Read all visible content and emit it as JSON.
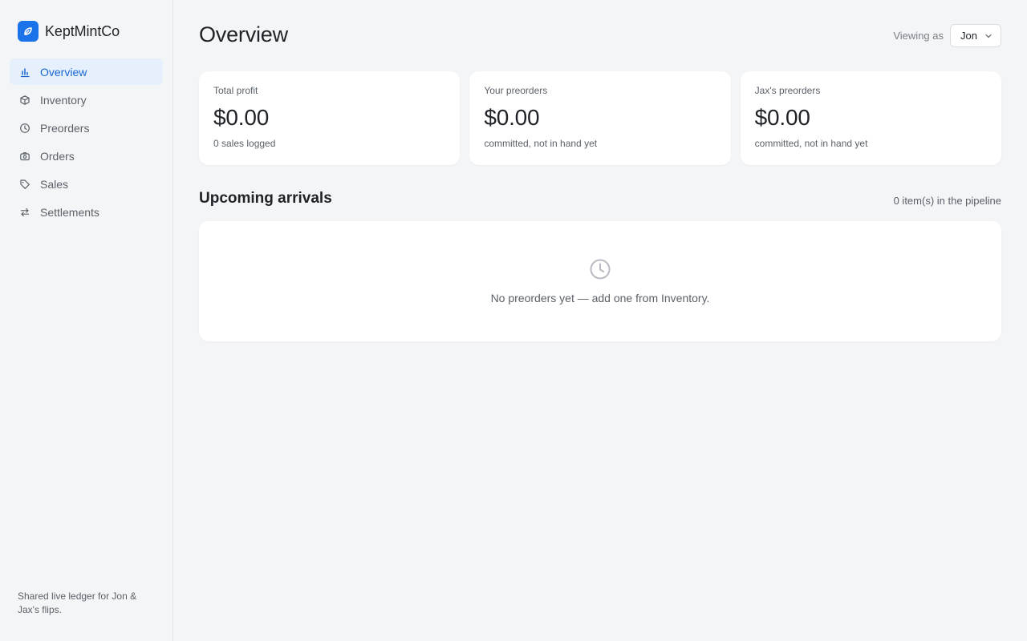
{
  "brand": {
    "name": "KeptMintCo",
    "logo_icon": "leaf-icon",
    "color": "#1a73e8"
  },
  "sidebar": {
    "items": [
      {
        "label": "Overview",
        "icon": "bar-chart-icon",
        "active": true
      },
      {
        "label": "Inventory",
        "icon": "box-icon",
        "active": false
      },
      {
        "label": "Preorders",
        "icon": "clock-icon",
        "active": false
      },
      {
        "label": "Orders",
        "icon": "camera-icon",
        "active": false
      },
      {
        "label": "Sales",
        "icon": "tag-icon",
        "active": false
      },
      {
        "label": "Settlements",
        "icon": "swap-icon",
        "active": false
      }
    ],
    "footer": "Shared live ledger for Jon & Jax's flips."
  },
  "header": {
    "title": "Overview",
    "viewing_label": "Viewing as",
    "viewer": "Jon"
  },
  "cards": [
    {
      "label": "Total profit",
      "value": "$0.00",
      "sub": "0 sales logged"
    },
    {
      "label": "Your preorders",
      "value": "$0.00",
      "sub": "committed, not in hand yet"
    },
    {
      "label": "Jax's preorders",
      "value": "$0.00",
      "sub": "committed, not in hand yet"
    }
  ],
  "arrivals": {
    "title": "Upcoming arrivals",
    "count_text": "0 item(s) in the pipeline",
    "empty_text": "No preorders yet — add one from Inventory.",
    "empty_icon": "clock-icon"
  },
  "colors": {
    "accent": "#1967d2",
    "active_bg": "#e6f0fc",
    "background": "#f4f5f7"
  }
}
